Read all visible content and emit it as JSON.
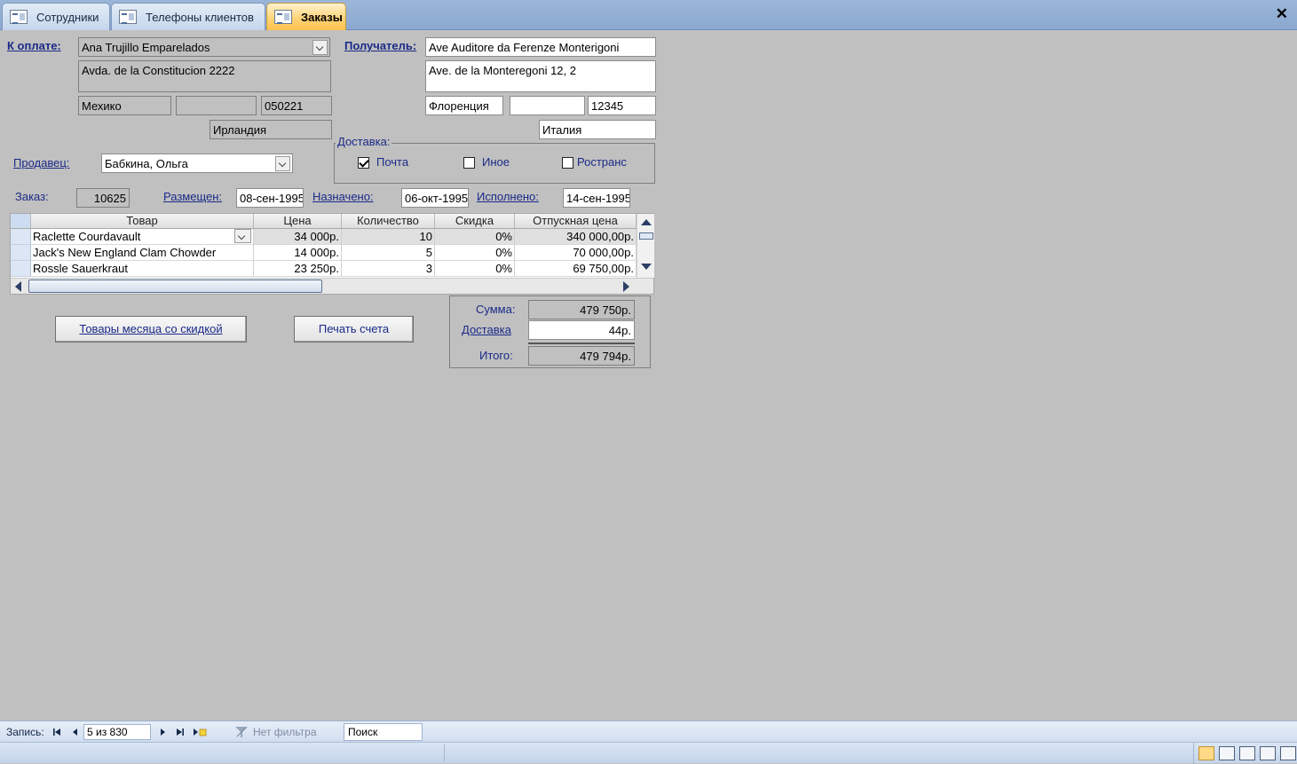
{
  "tabs": [
    {
      "label": "Сотрудники"
    },
    {
      "label": "Телефоны клиентов"
    },
    {
      "label": "Заказы"
    }
  ],
  "billing": {
    "label": "К оплате:",
    "name": "Ana Trujillo Emparelados",
    "address": "Avda. de la Constitucion 2222",
    "city": "Мехико",
    "region": "",
    "postal": "050221",
    "country": "Ирландия"
  },
  "recipient": {
    "label": "Получатель:",
    "name": "Ave Auditore da Ferenze Monterigoni",
    "address": "Ave. de la Monteregoni 12, 2",
    "city": "Флоренция",
    "region": "",
    "postal": "12345",
    "country": "Италия"
  },
  "seller": {
    "label": "Продавец:",
    "value": "Бабкина, Ольга"
  },
  "delivery": {
    "label": "Доставка:",
    "options": [
      {
        "label": "Почта",
        "checked": true
      },
      {
        "label": "Иное",
        "checked": false
      },
      {
        "label": "Ространс",
        "checked": false
      }
    ]
  },
  "order": {
    "order_label": "Заказ:",
    "order_id": "10625",
    "placed_label": "Размещен:",
    "placed": "08-сен-1995",
    "due_label": "Назначено:",
    "due": "06-окт-1995",
    "done_label": "Исполнено:",
    "done": "14-сен-1995"
  },
  "grid": {
    "headers": [
      "Товар",
      "Цена",
      "Количество",
      "Скидка",
      "Отпускная цена"
    ],
    "rows": [
      [
        "Raclette Courdavault",
        "34 000р.",
        "10",
        "0%",
        "340 000,00р."
      ],
      [
        "Jack's New England Clam Chowder",
        "14 000р.",
        "5",
        "0%",
        "70 000,00р."
      ],
      [
        "Rossle Sauerkraut",
        "23 250р.",
        "3",
        "0%",
        "69 750,00р."
      ]
    ]
  },
  "buttons": {
    "discount": "Товары месяца со скидкой",
    "print": "Печать счета"
  },
  "totals": {
    "sum_label": "Сумма:",
    "sum": "479 750р.",
    "shipping_label": "Доставка",
    "shipping": "44р.",
    "total_label": "Итого:",
    "total": "479 794р."
  },
  "nav": {
    "record_label": "Запись:",
    "record_value": "5 из 830",
    "filter": "Нет фильтра",
    "search": "Поиск"
  }
}
